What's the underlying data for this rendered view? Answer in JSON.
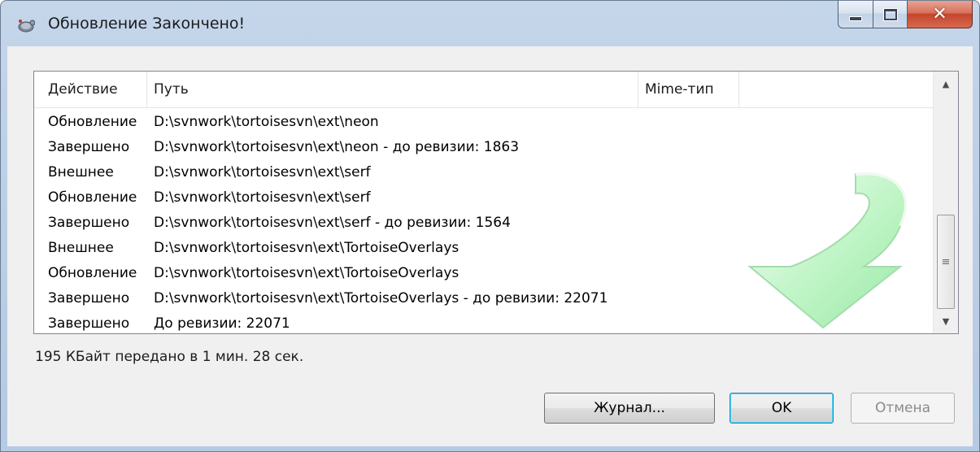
{
  "window": {
    "title": "Обновление Закончено!"
  },
  "list": {
    "columns": [
      "Действие",
      "Путь",
      "Mime-тип"
    ],
    "rows": [
      {
        "action": "Обновление",
        "path": "D:\\svnwork\\tortoisesvn\\ext\\neon"
      },
      {
        "action": "Завершено",
        "path": "D:\\svnwork\\tortoisesvn\\ext\\neon - до ревизии: 1863"
      },
      {
        "action": "Внешнее",
        "path": "D:\\svnwork\\tortoisesvn\\ext\\serf"
      },
      {
        "action": "Обновление",
        "path": "D:\\svnwork\\tortoisesvn\\ext\\serf"
      },
      {
        "action": "Завершено",
        "path": "D:\\svnwork\\tortoisesvn\\ext\\serf - до ревизии: 1564"
      },
      {
        "action": "Внешнее",
        "path": "D:\\svnwork\\tortoisesvn\\ext\\TortoiseOverlays"
      },
      {
        "action": "Обновление",
        "path": "D:\\svnwork\\tortoisesvn\\ext\\TortoiseOverlays"
      },
      {
        "action": "Завершено",
        "path": "D:\\svnwork\\tortoisesvn\\ext\\TortoiseOverlays - до ревизии: 22071"
      },
      {
        "action": "Завершено",
        "path": "До ревизии: 22071"
      }
    ]
  },
  "status": {
    "text": "195 КБайт передано в 1 мин. 28 сек."
  },
  "buttons": {
    "log": "Журнал...",
    "ok": "OK",
    "cancel": "Отмена"
  },
  "icons": {
    "app": "tortoisesvn-icon",
    "decoration": "update-arrow-icon",
    "scroll_up": "scroll-up-arrow-icon",
    "scroll_down": "scroll-down-arrow-icon"
  },
  "colors": {
    "accent": "#3c7fb1",
    "close": "#c4452c",
    "arrow": "#a8efb0"
  }
}
